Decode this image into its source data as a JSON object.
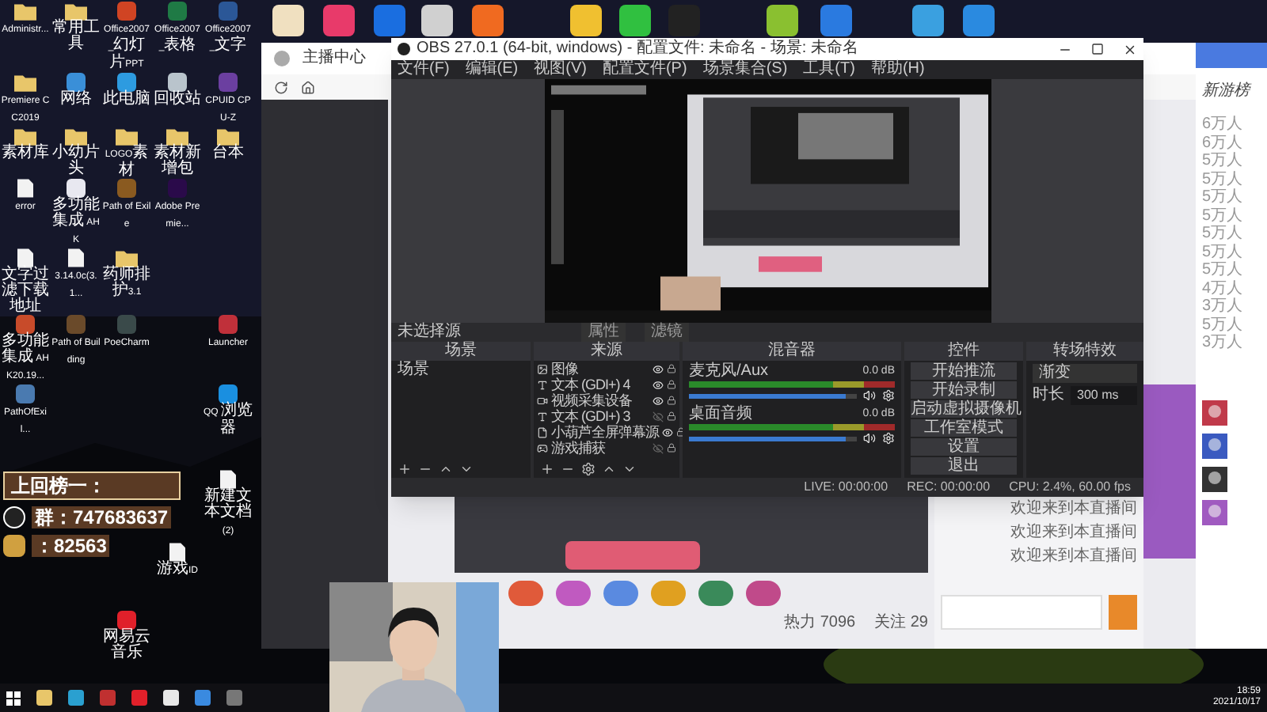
{
  "desktop": {
    "icons": [
      {
        "label": "Administr...",
        "kind": "folder"
      },
      {
        "label": "常用工具",
        "kind": "folder"
      },
      {
        "label": "Office2007_幻灯片PPT",
        "kind": "app",
        "color": "#d04423"
      },
      {
        "label": "Office2007_表格",
        "kind": "app",
        "color": "#1f7a45"
      },
      {
        "label": "Office2007_文字",
        "kind": "app",
        "color": "#2b5797"
      },
      {
        "label": "Premiere CC2019",
        "kind": "folder"
      },
      {
        "label": "网络",
        "kind": "app",
        "color": "#3a8fd8"
      },
      {
        "label": "此电脑",
        "kind": "app",
        "color": "#2d9be0"
      },
      {
        "label": "回收站",
        "kind": "app",
        "color": "#b9c4cc"
      },
      {
        "label": "CPUID CPU-Z",
        "kind": "app",
        "color": "#6b3fa0"
      },
      {
        "label": "素材库",
        "kind": "folder"
      },
      {
        "label": "小幼片头",
        "kind": "folder"
      },
      {
        "label": "LOGO素材",
        "kind": "folder"
      },
      {
        "label": "素材新增包",
        "kind": "folder"
      },
      {
        "label": "台本",
        "kind": "folder"
      },
      {
        "label": "error",
        "kind": "file"
      },
      {
        "label": "多功能集成 AHK",
        "kind": "app",
        "color": "#e8e8f0"
      },
      {
        "label": "Path of Exile",
        "kind": "app",
        "color": "#8a5a20"
      },
      {
        "label": "Adobe Premie...",
        "kind": "app",
        "color": "#2a0a4a"
      },
      {
        "label": "文字过滤下载地址",
        "kind": "file"
      },
      {
        "label": "3.14.0c(3.1...",
        "kind": "file"
      },
      {
        "label": "药师排护3.1",
        "kind": "folder"
      },
      {
        "label": "多功能集成 AHK20.19...",
        "kind": "app",
        "color": "#c84b2a"
      },
      {
        "label": "Path of Building",
        "kind": "app",
        "color": "#6a4a2a"
      },
      {
        "label": "PoeCharm",
        "kind": "app",
        "color": "#3a4a4a"
      },
      {
        "label": "Launcher",
        "kind": "app",
        "color": "#c0303a"
      },
      {
        "label": "PathOfExil...",
        "kind": "app",
        "color": "#4a7ab0"
      },
      {
        "label": "QQ 浏览器",
        "kind": "app",
        "color": "#1a8fe0"
      },
      {
        "label": "新建文本文档 (2)",
        "kind": "file"
      },
      {
        "label": "游戏ID",
        "kind": "file"
      },
      {
        "label": "网易云音乐",
        "kind": "app",
        "color": "#e0202a"
      }
    ],
    "top_icons": [
      {
        "color": "#f0e0c0"
      },
      {
        "color": "#e83a6a"
      },
      {
        "color": "#1a6ee0"
      },
      {
        "color": "#d0d0d0"
      },
      {
        "color": "#f06a20"
      },
      {
        "color": "#f0c030"
      },
      {
        "color": "#30c040"
      },
      {
        "color": "#222222"
      },
      {
        "color": "#8ac030"
      },
      {
        "color": "#2a7ae0"
      },
      {
        "color": "#3aa0e0"
      },
      {
        "color": "#2a8ae0"
      }
    ]
  },
  "overlay": {
    "banner": "上回榜一：",
    "qq_group": "群：747683637",
    "number": "：82563"
  },
  "browser": {
    "tab": "主播中心",
    "chat": [
      "欢迎来到本直播间",
      "欢迎来到本直播间",
      "欢迎来到本直播间"
    ],
    "stats": [
      "热力 7096",
      "关注 29"
    ]
  },
  "side_window": {
    "title": "新游榜",
    "ranks": [
      "6万人",
      "6万人",
      "5万人",
      "5万人",
      "5万人",
      "5万人",
      "5万人",
      "5万人",
      "5万人",
      "4万人",
      "3万人",
      "5万人",
      "3万人"
    ]
  },
  "obs": {
    "title": "OBS 27.0.1 (64-bit, windows) - 配置文件: 未命名 - 场景: 未命名",
    "menu": [
      "文件(F)",
      "编辑(E)",
      "视图(V)",
      "配置文件(P)",
      "场景集合(S)",
      "工具(T)",
      "帮助(H)"
    ],
    "source_bar": {
      "label": "未选择源",
      "buttons": [
        "属性",
        "滤镜"
      ]
    },
    "docks": [
      "场景",
      "来源",
      "混音器",
      "控件",
      "转场特效"
    ],
    "scenes": [
      "场景"
    ],
    "sources": [
      {
        "label": "图像",
        "visible": true
      },
      {
        "kind": "text",
        "label": "文本 (GDI+) 4",
        "visible": true
      },
      {
        "kind": "camera",
        "label": "视频采集设备",
        "visible": true
      },
      {
        "kind": "text",
        "label": "文本 (GDI+) 3",
        "visible": false
      },
      {
        "kind": "file",
        "label": "小葫芦全屏弹幕源",
        "visible": true
      },
      {
        "kind": "game",
        "label": "游戏捕获",
        "visible": false
      }
    ],
    "mixer": [
      {
        "name": "麦克风/Aux",
        "reading": "0.0 dB",
        "level": 0.93
      },
      {
        "name": "桌面音频",
        "reading": "0.0 dB",
        "level": 0.93
      }
    ],
    "controls": [
      "开始推流",
      "开始录制",
      "启动虚拟摄像机",
      "工作室模式",
      "设置",
      "退出"
    ],
    "transition": {
      "value": "渐变",
      "duration_label": "时长",
      "duration": "300 ms"
    },
    "status": [
      "LIVE: 00:00:00",
      "REC: 00:00:00",
      "CPU: 2.4%, 60.00 fps"
    ]
  },
  "taskbar": {
    "time": "18:59",
    "date": "2021/10/17"
  }
}
